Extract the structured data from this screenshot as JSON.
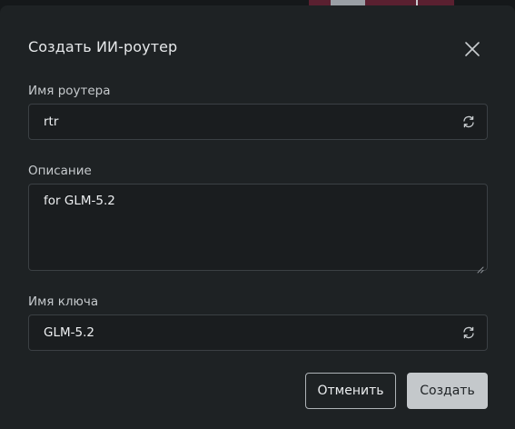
{
  "dialog": {
    "title": "Создать ИИ-роутер",
    "close_icon": "close-icon"
  },
  "router_name": {
    "label": "Имя роутера",
    "value": "rtr",
    "icon": "refresh-icon"
  },
  "description": {
    "label": "Описание",
    "value": "for GLM-5.2"
  },
  "key_name": {
    "label": "Имя ключа",
    "value": "GLM-5.2",
    "icon": "refresh-icon"
  },
  "actions": {
    "cancel_label": "Отменить",
    "create_label": "Создать"
  },
  "colors": {
    "dialog_bg": "#1e2224",
    "field_border": "#3b4044",
    "primary_button": "#c4c8cb"
  }
}
